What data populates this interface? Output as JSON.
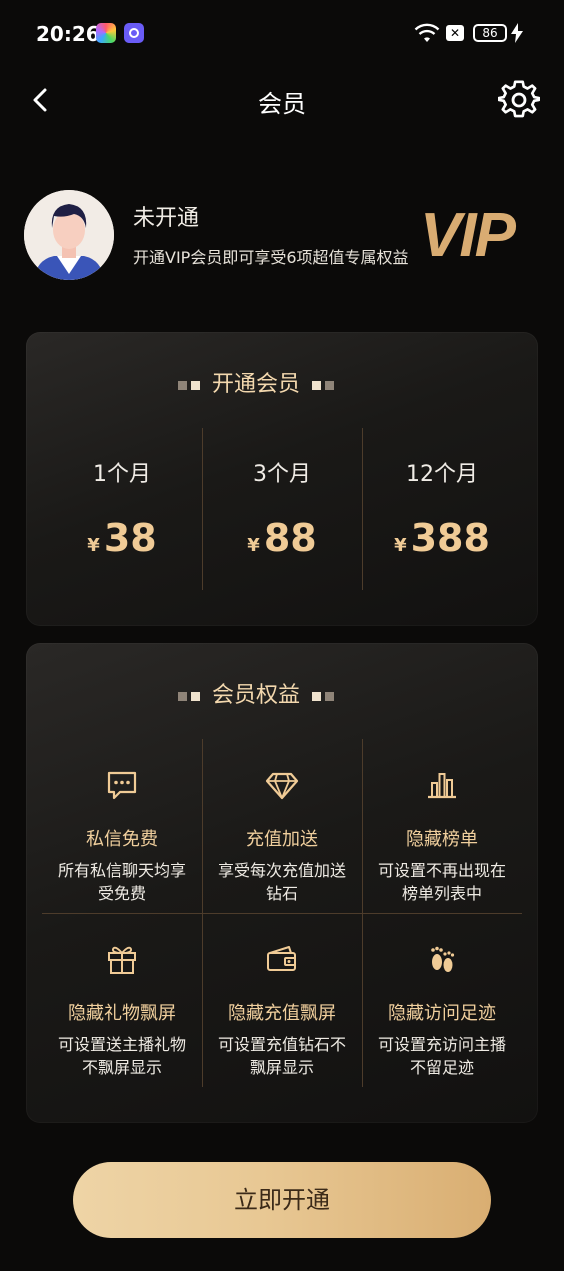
{
  "status_bar": {
    "time": "20:26",
    "battery": "86"
  },
  "nav": {
    "title": "会员"
  },
  "profile": {
    "status": "未开通",
    "description": "开通VIP会员即可享受6项超值专属权益",
    "vip_badge": "VIP"
  },
  "plans_card": {
    "heading": "开通会员",
    "plans": [
      {
        "duration": "1个月",
        "currency": "¥",
        "price": "38"
      },
      {
        "duration": "3个月",
        "currency": "¥",
        "price": "88"
      },
      {
        "duration": "12个月",
        "currency": "¥",
        "price": "388"
      }
    ]
  },
  "benefits_card": {
    "heading": "会员权益",
    "items": [
      {
        "icon": "message-icon",
        "title": "私信免费",
        "description": "所有私信聊天均享受免费"
      },
      {
        "icon": "diamond-icon",
        "title": "充值加送",
        "description": "享受每次充值加送钻石"
      },
      {
        "icon": "ranking-icon",
        "title": "隐藏榜单",
        "description": "可设置不再出现在榜单列表中"
      },
      {
        "icon": "gift-icon",
        "title": "隐藏礼物飘屏",
        "description": "可设置送主播礼物不飘屏显示"
      },
      {
        "icon": "recharge-icon",
        "title": "隐藏充值飘屏",
        "description": "可设置充值钻石不飘屏显示"
      },
      {
        "icon": "footprint-icon",
        "title": "隐藏访问足迹",
        "description": "可设置充访问主播不留足迹"
      }
    ]
  },
  "cta": {
    "label": "立即开通"
  },
  "colors": {
    "gold": "#f0cb96",
    "background": "#0b0a09",
    "cta_gradient_start": "#eed4a6",
    "cta_gradient_end": "#d9ae72"
  }
}
